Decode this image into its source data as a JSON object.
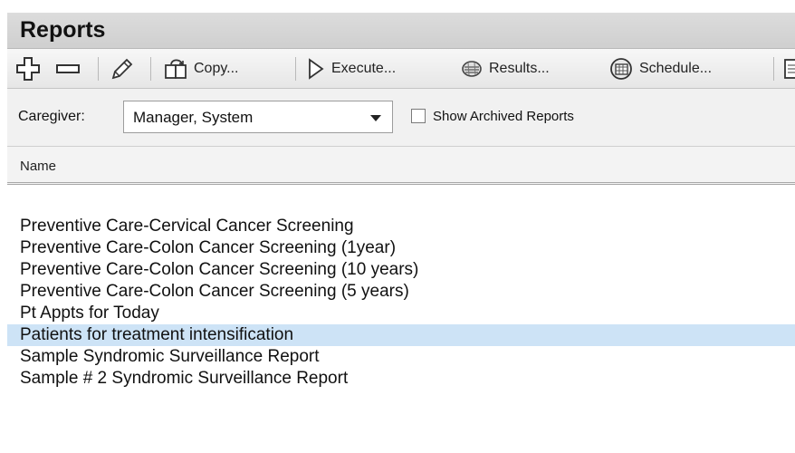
{
  "window": {
    "title": "Reports"
  },
  "toolbar": {
    "add_icon": "plus-outline-icon",
    "remove_icon": "minus-icon",
    "edit_icon": "pencil-icon",
    "copy_label": "Copy...",
    "execute_label": "Execute...",
    "results_label": "Results...",
    "schedule_label": "Schedule..."
  },
  "filters": {
    "caregiver_label": "Caregiver:",
    "caregiver_value": "Manager, System",
    "show_archived_label": "Show Archived Reports",
    "show_archived_checked": false
  },
  "table": {
    "column_name": "Name",
    "selected_index": 5,
    "selection_color": "#cde3f6",
    "rows": [
      "Preventive Care-Cervical Cancer Screening",
      "Preventive Care-Colon Cancer Screening (1year)",
      "Preventive Care-Colon Cancer Screening (10 years)",
      "Preventive Care-Colon Cancer Screening (5 years)",
      "Pt Appts for Today",
      "Patients for treatment intensification",
      "Sample Syndromic Surveillance Report",
      "Sample # 2 Syndromic Surveillance Report"
    ]
  }
}
